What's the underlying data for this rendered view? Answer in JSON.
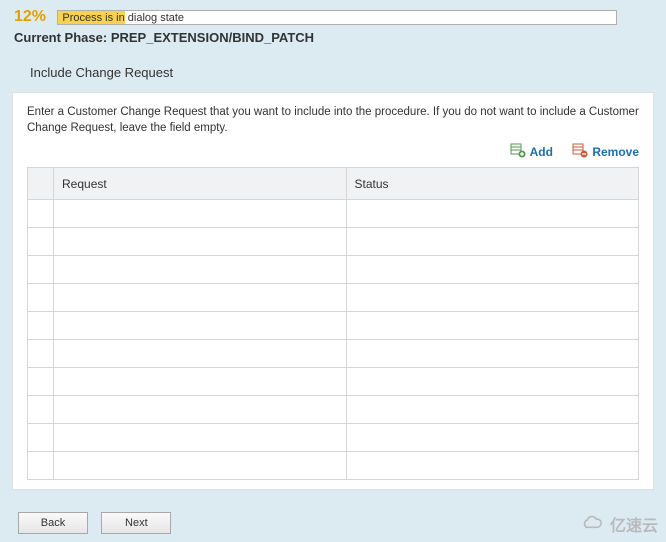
{
  "header": {
    "percent": "12%",
    "progress_text": "Process is in dialog state",
    "phase_label": "Current Phase:",
    "phase_value": "PREP_EXTENSION/BIND_PATCH"
  },
  "subtitle": "Include Change Request",
  "instruction": "Enter a Customer Change Request that you want to include into the procedure. If you do not want to include a Customer Change Request, leave the field empty.",
  "toolbar": {
    "add_label": "Add",
    "remove_label": "Remove"
  },
  "table": {
    "columns": [
      "Request",
      "Status"
    ],
    "rows": [
      {
        "request": "",
        "status": ""
      },
      {
        "request": "",
        "status": ""
      },
      {
        "request": "",
        "status": ""
      },
      {
        "request": "",
        "status": ""
      },
      {
        "request": "",
        "status": ""
      },
      {
        "request": "",
        "status": ""
      },
      {
        "request": "",
        "status": ""
      },
      {
        "request": "",
        "status": ""
      },
      {
        "request": "",
        "status": ""
      },
      {
        "request": "",
        "status": ""
      }
    ]
  },
  "footer": {
    "back_label": "Back",
    "next_label": "Next"
  },
  "watermark": "亿速云"
}
